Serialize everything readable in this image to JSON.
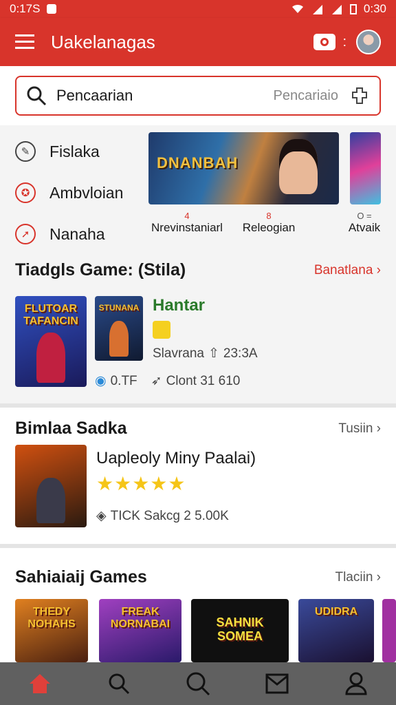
{
  "status": {
    "time": "0:17S",
    "clock": "0:30"
  },
  "appbar": {
    "title": "Uakelanagas"
  },
  "search": {
    "query": "Pencaarian",
    "placeholder": "Pencariaio"
  },
  "categories": [
    {
      "label": "Fislaka",
      "icon": "wrench-icon"
    },
    {
      "label": "Ambvloian",
      "icon": "target-icon"
    },
    {
      "label": "Nanaha",
      "icon": "arrow-icon"
    }
  ],
  "banner": {
    "title": "DNANBAH",
    "labels": [
      {
        "mark": "4",
        "text": "Nrevinstaniarl"
      },
      {
        "mark": "8",
        "text": "Releogian"
      },
      {
        "mark": "O =",
        "text": "Atvaik"
      }
    ]
  },
  "section1": {
    "title": "Tiadgls Game: (Stila)",
    "link": "Banatlana",
    "tile1_title": "FLUTOAR TAFANCIN",
    "tile2_title": "STUNANA",
    "game_title": "Hantar",
    "meta1": "Slavrana",
    "meta1b": "23:3A",
    "meta2": "0.TF",
    "meta2b": "Clont 31 610"
  },
  "section2": {
    "title": "Bimlaa Sadka",
    "link": "Tusiin",
    "tile_title": "",
    "game_title": "Uapleoly Miny Paalai)",
    "stars": "★★★★★",
    "meta": "TICK Sakcg 2 5.00K"
  },
  "section3": {
    "title": "Sahiaiaij Games",
    "link": "Tlaciin",
    "tiles": [
      "THEDY NOHAHS",
      "FREAK NORNABAI",
      "SAHNIK SOMEA",
      "UDIDRA"
    ]
  },
  "colors": {
    "accent": "#d8342b",
    "nav_bg": "#606060",
    "stars": "#f5c518"
  }
}
